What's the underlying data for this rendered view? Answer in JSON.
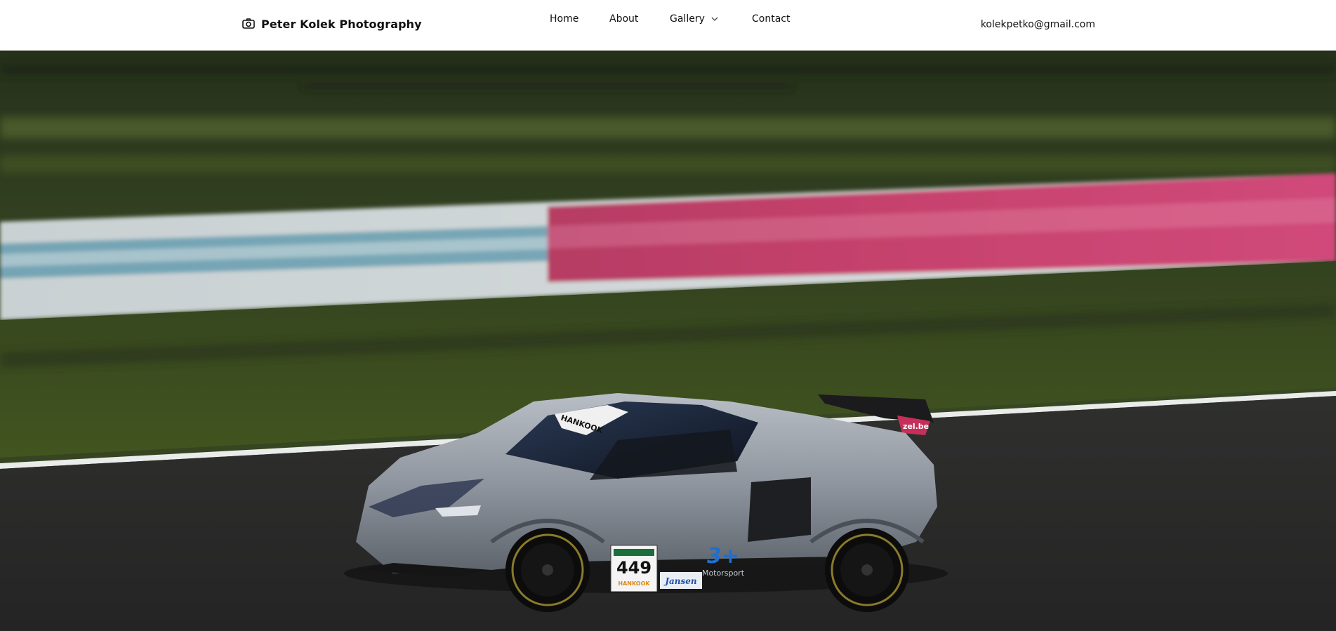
{
  "header": {
    "brand_title": "Peter Kolek Photography",
    "brand_icon": "camera-icon",
    "nav": {
      "home": "Home",
      "about": "About",
      "gallery": "Gallery",
      "contact": "Contact"
    },
    "gallery_icon": "chevron-down-icon",
    "email": "kolekpetko@gmail.com"
  },
  "hero": {
    "car_number": "449",
    "sponsor_roof": "HANKOOK",
    "sponsor_small": "HANKOOK",
    "sponsor_door": "Jansen",
    "sponsor_motorsport": "Motorsport",
    "wing_text": "zel.be"
  },
  "colors": {
    "header_bg": "#ffffff",
    "text": "#111111",
    "grass": "#3a4a25",
    "track": "#2b2b2b",
    "barrier_blue": "#2f7f9a",
    "barrier_pink": "#c8426e",
    "car_body": "#9aa1aa"
  }
}
